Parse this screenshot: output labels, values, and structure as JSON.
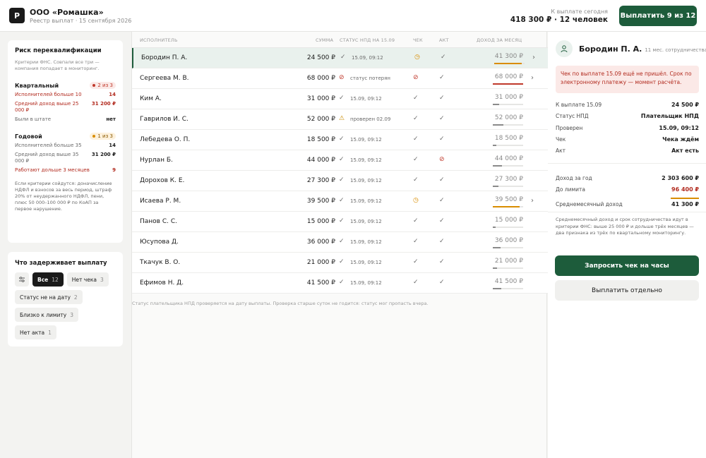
{
  "header": {
    "logo_letter": "Р",
    "company": "ООО «Ромашка»",
    "subtitle": "Реестр выплат · 15 сентября 2026",
    "pay_today_label": "К выплате сегодня",
    "pay_today_total": "418 300 ₽ · 12 человек",
    "pay_button": "Выплатить 9 из 12"
  },
  "risk": {
    "title": "Риск переквалификации",
    "desc": "Критерии ФНС. Совпали все три — компания попадает в мониторинг.",
    "quarterly": {
      "title": "Квартальный",
      "badge": "2 из 3",
      "items": [
        {
          "label": "Исполнителей больше 10",
          "value": "14"
        },
        {
          "label": "Средний доход выше 25 000 ₽",
          "value": "31 200 ₽"
        },
        {
          "label": "Были в штате",
          "value": "нет"
        }
      ]
    },
    "yearly": {
      "title": "Годовой",
      "badge": "1 из 3",
      "items": [
        {
          "label": "Исполнителей больше 35",
          "value": "14"
        },
        {
          "label": "Средний доход выше 35 000 ₽",
          "value": "31 200 ₽"
        },
        {
          "label": "Работают дольше 3 месяцев",
          "value": "9"
        }
      ]
    },
    "note": "Если критерии сойдутся: доначисление НДФЛ и взносов за весь период, штраф 20% от неудержанного НДФЛ, пени, плюс 50 000–100 000 ₽ по КоАП за первое нарушение."
  },
  "filters": {
    "title": "Что задерживает выплату",
    "chips": [
      {
        "label": "Все",
        "count": "12"
      },
      {
        "label": "Нет чека",
        "count": "3"
      },
      {
        "label": "Статус не на дату",
        "count": "2"
      },
      {
        "label": "Близко к лимиту",
        "count": "3"
      },
      {
        "label": "Нет акта",
        "count": "1"
      }
    ]
  },
  "table": {
    "headers": {
      "name": "Исполнитель",
      "sum": "Сумма",
      "status": "Статус НПД на 15.09",
      "check": "Чек",
      "act": "Акт",
      "income": "Доход за месяц"
    },
    "rows": [
      {
        "name": "Бородин П. А.",
        "sum": "24 500 ₽",
        "status_icon": "✓",
        "status": "15.09, 09:12",
        "check": "◷",
        "act": "✓",
        "income": "41 300 ₽",
        "fill": 0.9,
        "bar": "amber",
        "chev": "›"
      },
      {
        "name": "Сергеева М. В.",
        "sum": "68 000 ₽",
        "status_icon": "⊘",
        "status": "статус потерян",
        "check": "⊘",
        "act": "✓",
        "income": "68 000 ₽",
        "fill": 1.0,
        "bar": "red",
        "chev": "›"
      },
      {
        "name": "Ким А.",
        "sum": "31 000 ₽",
        "status_icon": "✓",
        "status": "15.09, 09:12",
        "check": "✓",
        "act": "✓",
        "income": "31 000 ₽",
        "fill": 0.2,
        "bar": "grey",
        "chev": ""
      },
      {
        "name": "Гаврилов И. С.",
        "sum": "52 000 ₽",
        "status_icon": "⚠",
        "status": "проверен 02.09",
        "check": "✓",
        "act": "✓",
        "income": "52 000 ₽",
        "fill": 0.35,
        "bar": "grey",
        "chev": ""
      },
      {
        "name": "Лебедева О. П.",
        "sum": "18 500 ₽",
        "status_icon": "✓",
        "status": "15.09, 09:12",
        "check": "✓",
        "act": "✓",
        "income": "18 500 ₽",
        "fill": 0.12,
        "bar": "grey",
        "chev": ""
      },
      {
        "name": "Нурлан Б.",
        "sum": "44 000 ₽",
        "status_icon": "✓",
        "status": "15.09, 09:12",
        "check": "✓",
        "act": "⊘",
        "income": "44 000 ₽",
        "fill": 0.3,
        "bar": "grey",
        "chev": ""
      },
      {
        "name": "Дорохов К. Е.",
        "sum": "27 300 ₽",
        "status_icon": "✓",
        "status": "15.09, 09:12",
        "check": "✓",
        "act": "✓",
        "income": "27 300 ₽",
        "fill": 0.18,
        "bar": "grey",
        "chev": ""
      },
      {
        "name": "Исаева Р. М.",
        "sum": "39 500 ₽",
        "status_icon": "✓",
        "status": "15.09, 09:12",
        "check": "◷",
        "act": "✓",
        "income": "39 500 ₽",
        "fill": 0.88,
        "bar": "amber",
        "chev": "›"
      },
      {
        "name": "Панов С. С.",
        "sum": "15 000 ₽",
        "status_icon": "✓",
        "status": "15.09, 09:12",
        "check": "✓",
        "act": "✓",
        "income": "15 000 ₽",
        "fill": 0.1,
        "bar": "grey",
        "chev": ""
      },
      {
        "name": "Юсупова Д.",
        "sum": "36 000 ₽",
        "status_icon": "✓",
        "status": "15.09, 09:12",
        "check": "✓",
        "act": "✓",
        "income": "36 000 ₽",
        "fill": 0.25,
        "bar": "grey",
        "chev": ""
      },
      {
        "name": "Ткачук В. О.",
        "sum": "21 000 ₽",
        "status_icon": "✓",
        "status": "15.09, 09:12",
        "check": "✓",
        "act": "✓",
        "income": "21 000 ₽",
        "fill": 0.14,
        "bar": "grey",
        "chev": ""
      },
      {
        "name": "Ефимов Н. Д.",
        "sum": "41 500 ₽",
        "status_icon": "✓",
        "status": "15.09, 09:12",
        "check": "✓",
        "act": "✓",
        "income": "41 500 ₽",
        "fill": 0.28,
        "bar": "grey",
        "chev": ""
      }
    ],
    "footnote": "Статус плательщика НПД проверяется на дату выплаты. Проверка старше суток не годится: статус мог пропасть вчера."
  },
  "detail": {
    "name": "Бородин П. А.",
    "tenure": "11 мес. сотрудничества",
    "alert": "Чек по выплате 15.09 ещё не пришёл. Срок по электронному платежу — момент расчёта.",
    "fields": [
      {
        "k": "К выплате 15.09",
        "v": "24 500 ₽"
      },
      {
        "k": "Статус НПД",
        "v": "Плательщик НПД"
      },
      {
        "k": "Проверен",
        "v": "15.09, 09:12"
      },
      {
        "k": "Чек",
        "v": "Чека ждём"
      },
      {
        "k": "Акт",
        "v": "Акт есть"
      }
    ],
    "income": [
      {
        "k": "Доход за год",
        "v": "2 303 600 ₽"
      },
      {
        "k": "До лимита",
        "v": "96 400 ₽"
      },
      {
        "k": "Среднемесячный доход",
        "v": "41 300 ₽"
      }
    ],
    "note": "Среднемесячный доход и срок сотрудничества идут в критерии ФНС: выше 25 000 ₽ и дольше трёх месяцев — два признака из трёх по квартальному мониторингу.",
    "primary_button": "Запросить чек на часы",
    "secondary_button": "Выплатить отдельно"
  }
}
